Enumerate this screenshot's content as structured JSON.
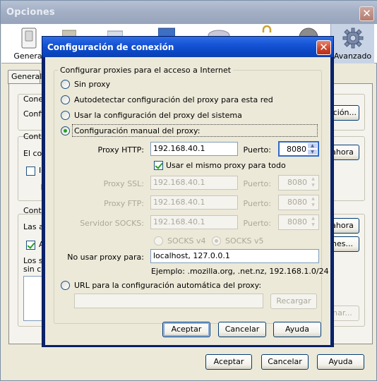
{
  "options_window": {
    "title": "Opciones",
    "close_glyph": "✕",
    "toolbar": [
      {
        "label": "General",
        "icon": "switch-icon"
      },
      {
        "label": "Avanzado",
        "icon": "gear-icon"
      }
    ],
    "tabs": [
      {
        "label": "General"
      }
    ],
    "background_fragments": {
      "conex": "Conex",
      "config": "Config",
      "conten1": "Conte",
      "el_con": "El con",
      "ig": "Ig",
      "l": "L",
      "conten2": "Conte",
      "las_ap": "Las ap",
      "a": "A",
      "los_si": "Los si",
      "sin_co": "sin co"
    },
    "side_buttons": {
      "configuracion": "ación...",
      "limpiar_ahora1": "ahora",
      "limpiar_ahora2": "ahora",
      "excepciones": "nes...",
      "eliminar": "nar..."
    },
    "buttons": {
      "accept": "Aceptar",
      "cancel": "Cancelar",
      "help": "Ayuda"
    }
  },
  "connection_dialog": {
    "title": "Configuración de conexión",
    "close_glyph": "✕",
    "group_label": "Configurar proxies para el acceso a Internet",
    "options": {
      "no_proxy": "Sin proxy",
      "autodetect": "Autodetectar configuración del proxy para esta red",
      "system": "Usar la configuración del proxy del sistema",
      "manual": "Configuración manual del proxy:",
      "auto_url": "URL para la configuración automática del proxy:"
    },
    "selected_option": "manual",
    "fields": {
      "http": {
        "label": "Proxy HTTP:",
        "value": "192.168.40.1",
        "port_label": "Puerto:",
        "port": "8080"
      },
      "same_proxy": {
        "label": "Usar el mismo proxy para todo",
        "checked": true
      },
      "ssl": {
        "label": "Proxy SSL:",
        "value": "192.168.40.1",
        "port_label": "Puerto:",
        "port": "8080"
      },
      "ftp": {
        "label": "Proxy FTP:",
        "value": "192.168.40.1",
        "port_label": "Puerto:",
        "port": "8080"
      },
      "socks": {
        "label": "Servidor SOCKS:",
        "value": "192.168.40.1",
        "port_label": "Puerto:",
        "port": "8080"
      },
      "socks_v4": "SOCKS v4",
      "socks_v5": "SOCKS v5",
      "no_proxy_for": {
        "label": "No usar proxy para:",
        "value": "localhost, 127.0.0.1"
      },
      "example": "Ejemplo: .mozilla.org, .net.nz, 192.168.1.0/24",
      "auto_url_value": ""
    },
    "buttons": {
      "reload": "Recargar",
      "accept": "Aceptar",
      "cancel": "Cancelar",
      "help": "Ayuda"
    }
  }
}
